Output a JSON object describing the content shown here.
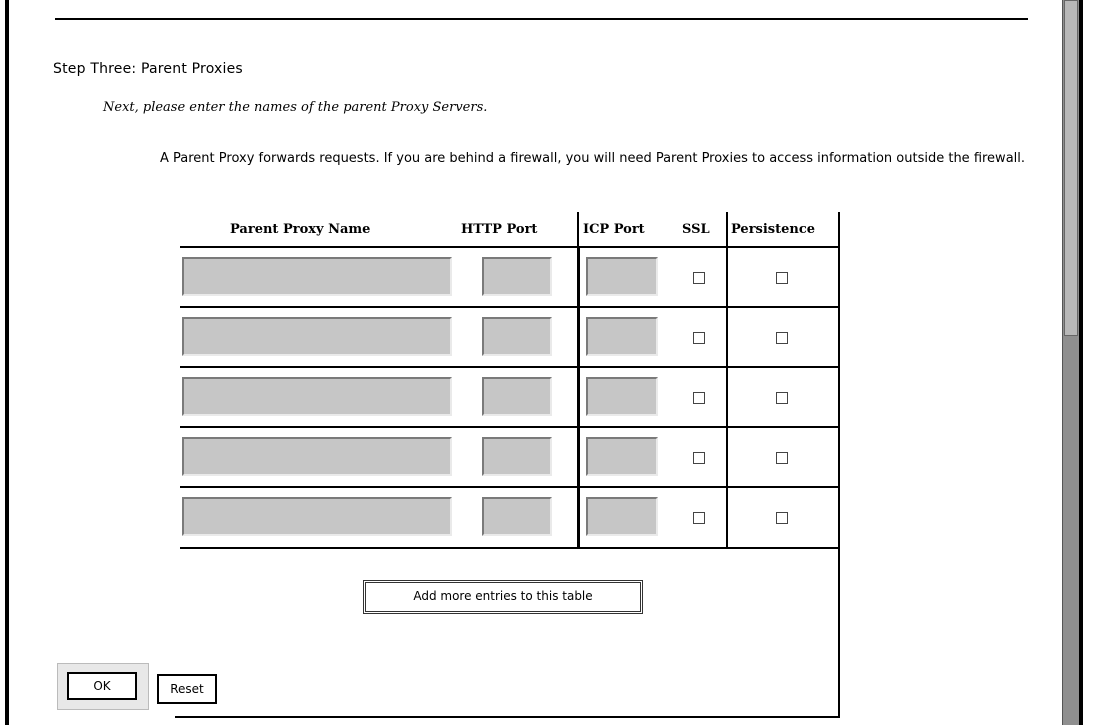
{
  "step": {
    "heading": "Step Three: Parent Proxies"
  },
  "instruction": "Next, please enter the names of the parent Proxy Servers.",
  "description": "A Parent Proxy forwards requests. If you are behind a firewall, you will need Parent Proxies to access information outside the firewall.",
  "table": {
    "columns": [
      "Parent Proxy Name",
      "HTTP Port",
      "ICP Port",
      "SSL",
      "Persistence"
    ],
    "rows": [
      {
        "name": "",
        "http_port": "",
        "icp_port": "",
        "ssl": false,
        "persistence": false
      },
      {
        "name": "",
        "http_port": "",
        "icp_port": "",
        "ssl": false,
        "persistence": false
      },
      {
        "name": "",
        "http_port": "",
        "icp_port": "",
        "ssl": false,
        "persistence": false
      },
      {
        "name": "",
        "http_port": "",
        "icp_port": "",
        "ssl": false,
        "persistence": false
      },
      {
        "name": "",
        "http_port": "",
        "icp_port": "",
        "ssl": false,
        "persistence": false
      }
    ],
    "add_button_label": "Add more entries to this table"
  },
  "buttons": {
    "ok": "OK",
    "reset": "Reset"
  },
  "colors": {
    "field_bg": "#c6c6c6",
    "scrollbar": "#8f8f8f"
  }
}
